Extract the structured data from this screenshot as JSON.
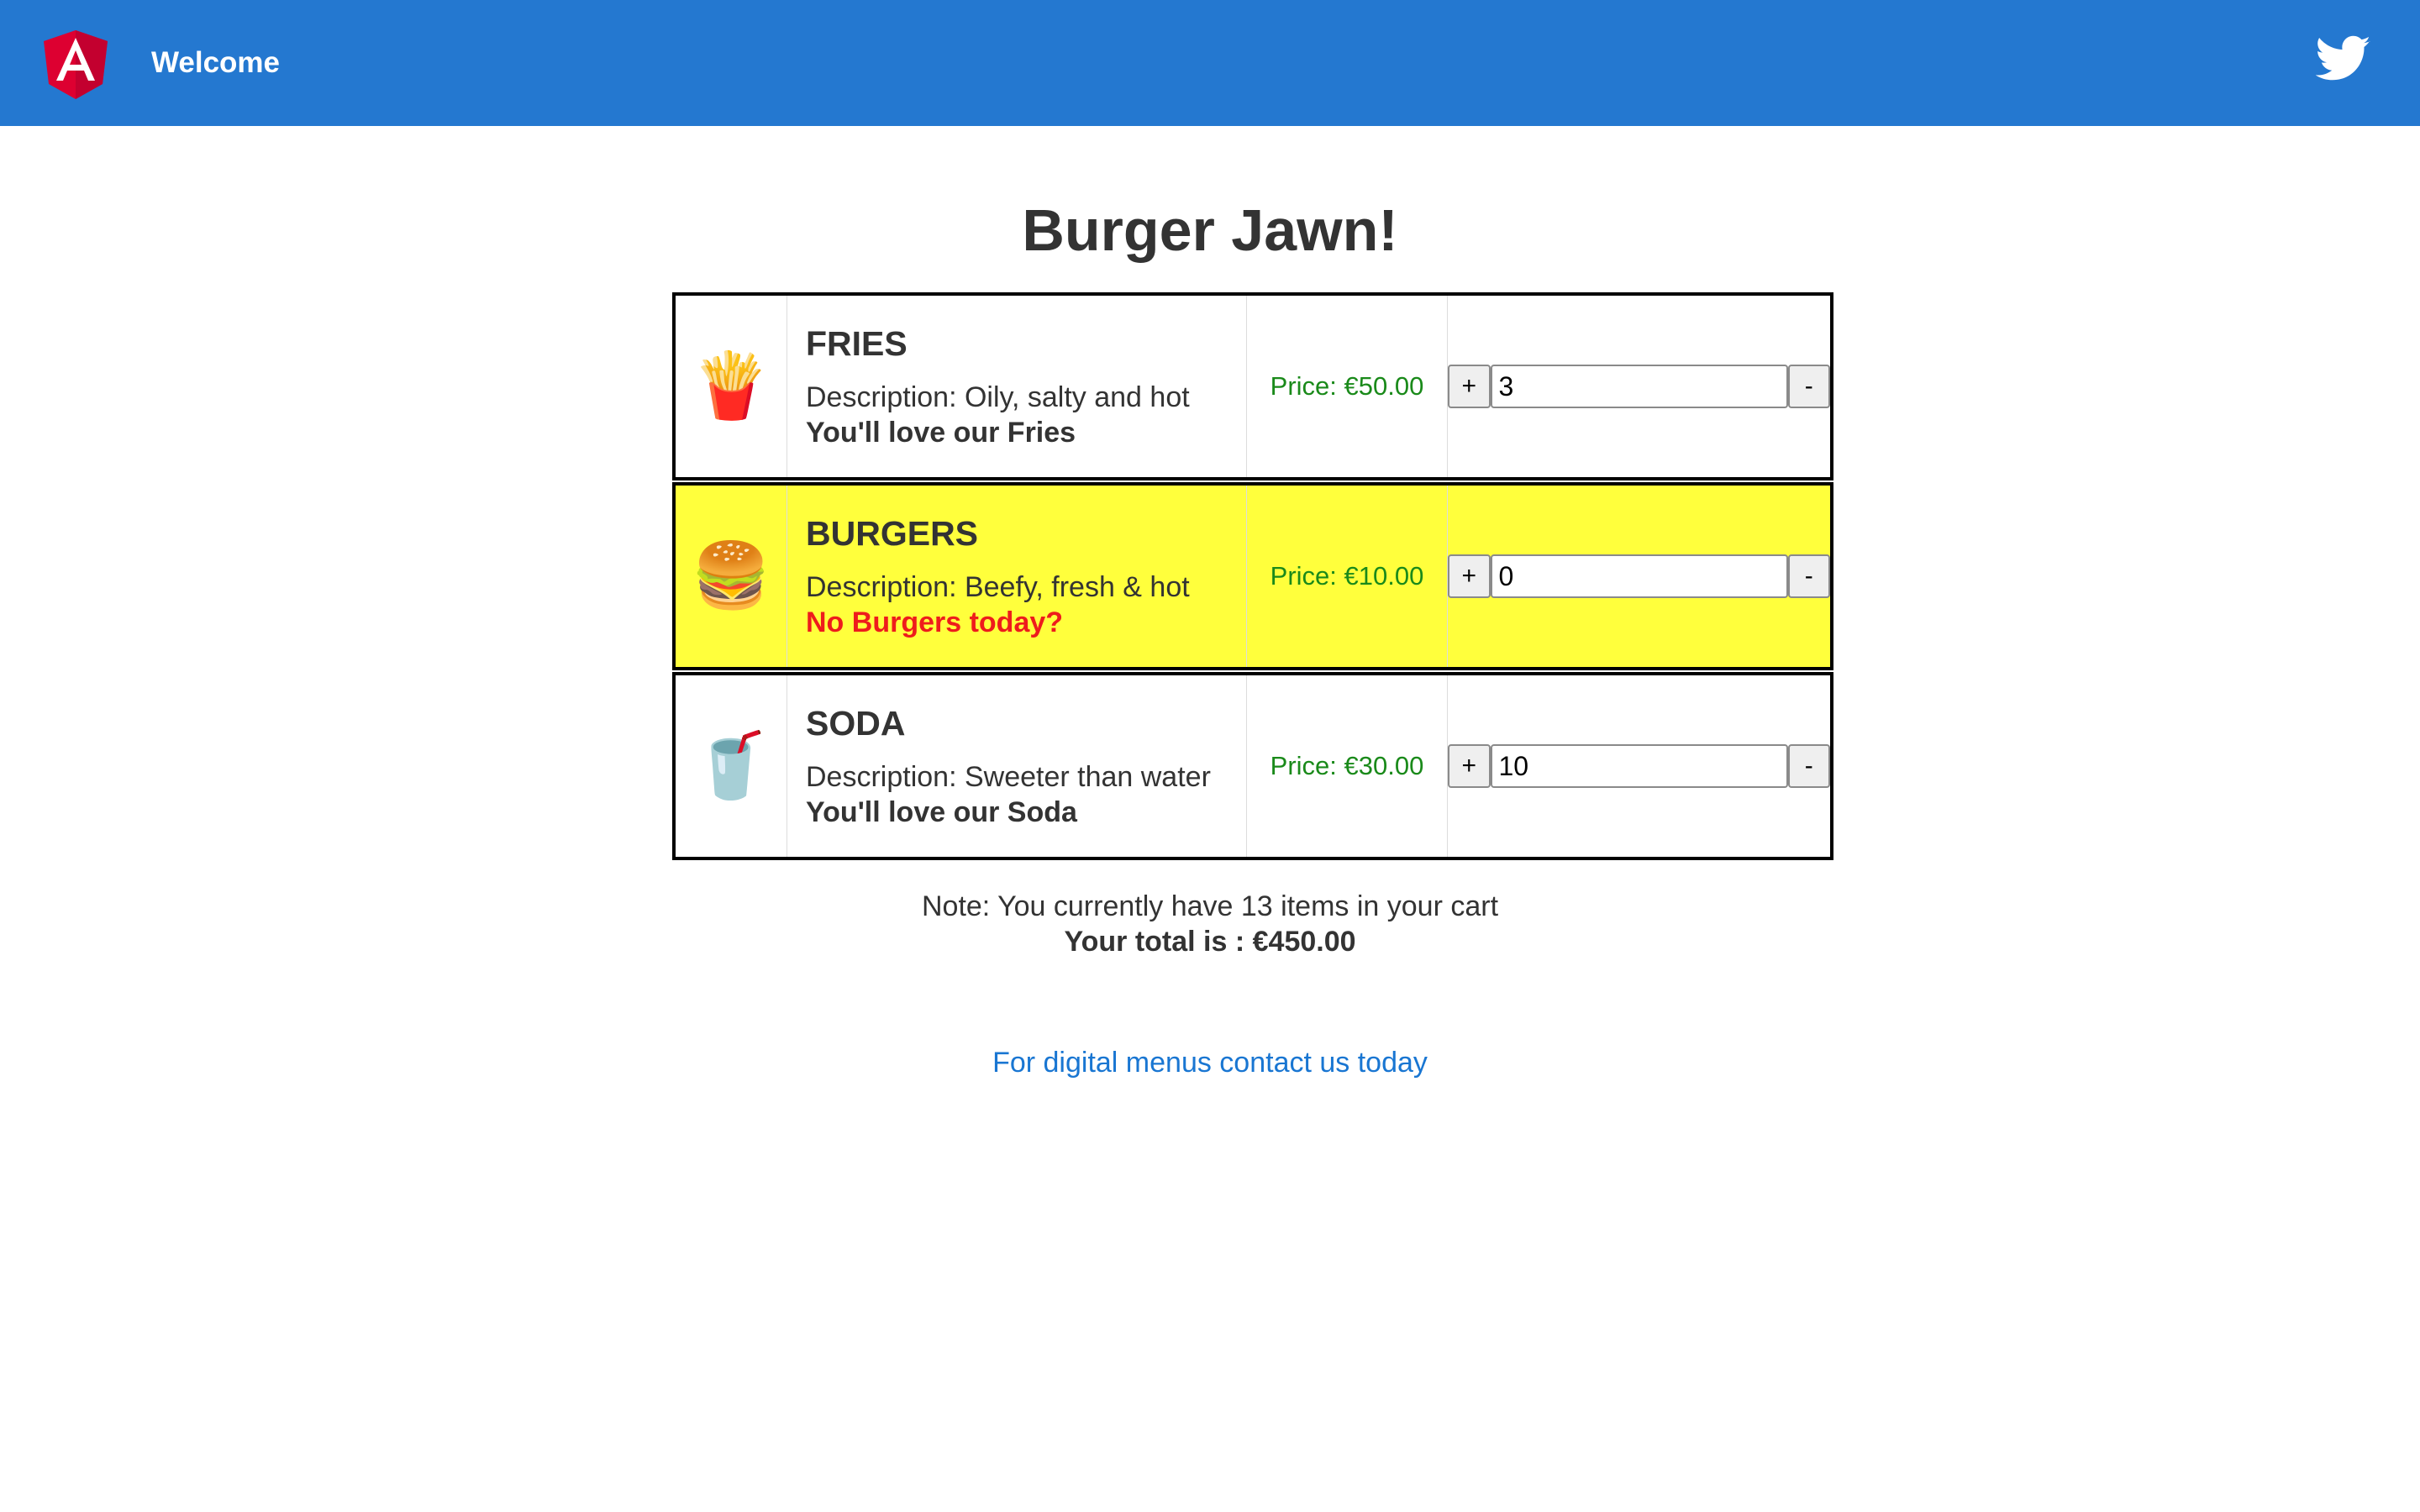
{
  "header": {
    "welcome": "Welcome",
    "background_color": "#2478d0",
    "logo_icon": "angular-logo-icon",
    "social_icon": "twitter-icon"
  },
  "main": {
    "title": "Burger Jawn!",
    "items": [
      {
        "emoji": "🍟",
        "icon": "fries-icon",
        "name": "FRIES",
        "description": "Description: Oily, salty and hot",
        "tagline": "You'll love our Fries",
        "price": "Price: €50.00",
        "quantity": "3",
        "highlighted": false
      },
      {
        "emoji": "🍔",
        "icon": "burger-icon",
        "name": "BURGERS",
        "description": "Description: Beefy, fresh & hot",
        "tagline": "No Burgers today?",
        "price": "Price: €10.00",
        "quantity": "0",
        "highlighted": true,
        "highlight_color": "#ffff3c",
        "tagline_color": "#ee1c1c"
      },
      {
        "emoji": "🥤",
        "icon": "soda-icon",
        "name": "SODA",
        "description": "Description: Sweeter than water",
        "tagline": "You'll love our Soda",
        "price": "Price: €30.00",
        "quantity": "10",
        "highlighted": false
      }
    ],
    "plus_label": "+",
    "minus_label": "-",
    "price_color": "#1a8a1a"
  },
  "summary": {
    "note": "Note: You currently have 13 items in your cart",
    "total": "Your total is : €450.00"
  },
  "contact": {
    "link_text": "For digital menus contact us today",
    "link_color": "#1976d2"
  }
}
